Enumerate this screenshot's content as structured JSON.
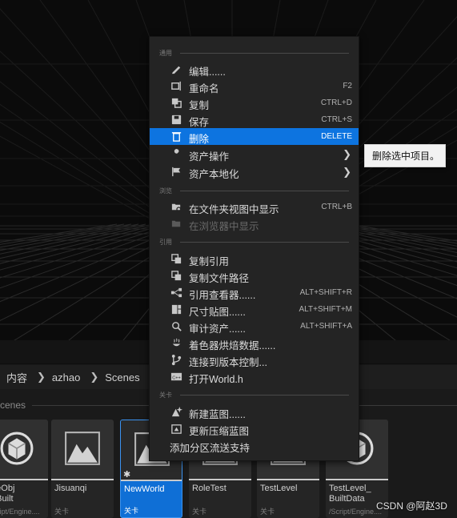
{
  "context_menu": {
    "sections": [
      {
        "header": "通用",
        "items": [
          {
            "label": "编辑......",
            "shortcut": "",
            "icon": "pencil-icon",
            "state": "normal",
            "submenu": false
          },
          {
            "label": "重命名",
            "shortcut": "F2",
            "icon": "rename-icon",
            "state": "normal",
            "submenu": false
          },
          {
            "label": "复制",
            "shortcut": "CTRL+D",
            "icon": "duplicate-icon",
            "state": "normal",
            "submenu": false
          },
          {
            "label": "保存",
            "shortcut": "CTRL+S",
            "icon": "save-icon",
            "state": "normal",
            "submenu": false
          },
          {
            "label": "删除",
            "shortcut": "DELETE",
            "icon": "trash-icon",
            "state": "active",
            "submenu": false
          },
          {
            "label": "资产操作",
            "shortcut": "",
            "icon": "wrench-icon",
            "state": "normal",
            "submenu": true
          },
          {
            "label": "资产本地化",
            "shortcut": "",
            "icon": "flag-icon",
            "state": "normal",
            "submenu": true
          }
        ]
      },
      {
        "header": "浏览",
        "items": [
          {
            "label": "在文件夹视图中显示",
            "shortcut": "CTRL+B",
            "icon": "folder-search-icon",
            "state": "normal",
            "submenu": false
          },
          {
            "label": "在浏览器中显示",
            "shortcut": "",
            "icon": "explorer-icon",
            "state": "disabled",
            "submenu": false
          }
        ]
      },
      {
        "header": "引用",
        "items": [
          {
            "label": "复制引用",
            "shortcut": "",
            "icon": "copy-reference-icon",
            "state": "normal",
            "submenu": false
          },
          {
            "label": "复制文件路径",
            "shortcut": "",
            "icon": "copy-path-icon",
            "state": "normal",
            "submenu": false
          },
          {
            "label": "引用查看器......",
            "shortcut": "ALT+SHIFT+R",
            "icon": "reference-viewer-icon",
            "state": "normal",
            "submenu": false
          },
          {
            "label": "尺寸贴图......",
            "shortcut": "ALT+SHIFT+M",
            "icon": "size-map-icon",
            "state": "normal",
            "submenu": false
          },
          {
            "label": "审计资产......",
            "shortcut": "ALT+SHIFT+A",
            "icon": "audit-icon",
            "state": "normal",
            "submenu": false
          },
          {
            "label": "着色器烘焙数据......",
            "shortcut": "",
            "icon": "shader-icon",
            "state": "normal",
            "submenu": false
          },
          {
            "label": "连接到版本控制...",
            "shortcut": "",
            "icon": "source-control-icon",
            "state": "normal",
            "submenu": false
          },
          {
            "label": "打开World.h",
            "shortcut": "",
            "icon": "cpp-file-icon",
            "state": "normal",
            "submenu": false
          }
        ]
      },
      {
        "header": "关卡",
        "items": [
          {
            "label": "新建蓝图......",
            "shortcut": "",
            "icon": "new-blueprint-icon",
            "state": "normal",
            "submenu": false
          },
          {
            "label": "更新压缩蓝图",
            "shortcut": "",
            "icon": "update-blueprint-icon",
            "state": "normal",
            "submenu": false
          },
          {
            "label": "添加分区流送支持",
            "shortcut": "",
            "icon": "",
            "state": "normal",
            "submenu": false
          }
        ]
      }
    ]
  },
  "tooltip": {
    "text": "删除选中项目。"
  },
  "breadcrumb": {
    "items": [
      "内容",
      "azhao",
      "Scenes"
    ]
  },
  "folder_header": {
    "label": "cenes"
  },
  "assets": [
    {
      "name": "ateObj",
      "name2": "t_Built",
      "sub": "Script/Engine....",
      "type": "",
      "thumb": "level-icon",
      "selected": false
    },
    {
      "name": "Jisuanqi",
      "name2": "",
      "sub": "",
      "type": "关卡",
      "thumb": "level-mountain-icon",
      "selected": false
    },
    {
      "name": "NewWorld",
      "name2": "",
      "sub": "",
      "type": "关卡",
      "thumb": "level-mountain-icon",
      "selected": true
    },
    {
      "name": "RoleTest",
      "name2": "",
      "sub": "",
      "type": "关卡",
      "thumb": "level-mountain-icon",
      "selected": false
    },
    {
      "name": "TestLevel",
      "name2": "",
      "sub": "",
      "type": "关卡",
      "thumb": "level-mountain-icon",
      "selected": false
    },
    {
      "name": "TestLevel_",
      "name2": "BuiltData",
      "sub": "/Script/Engine....",
      "type": "",
      "thumb": "level-icon",
      "selected": false
    }
  ],
  "watermark": {
    "text": "CSDN @阿赵3D"
  }
}
